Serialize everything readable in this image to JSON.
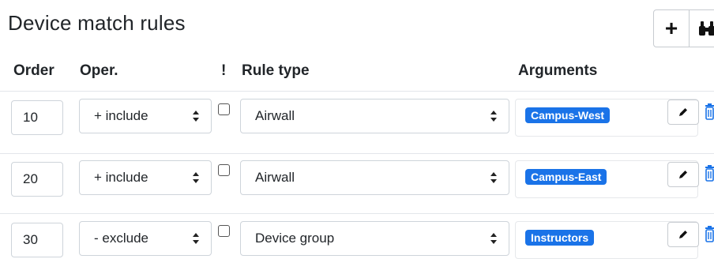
{
  "header": {
    "title": "Device match rules"
  },
  "toolbar": {
    "add_label": "+",
    "find_icon": "binoculars-icon"
  },
  "columns": {
    "order": "Order",
    "oper": "Oper.",
    "negate": "!",
    "rule_type": "Rule type",
    "arguments": "Arguments"
  },
  "rows": [
    {
      "order": "10",
      "oper": "+ include",
      "negate": false,
      "rule_type": "Airwall",
      "argument": "Campus-West"
    },
    {
      "order": "20",
      "oper": "+ include",
      "negate": false,
      "rule_type": "Airwall",
      "argument": "Campus-East"
    },
    {
      "order": "30",
      "oper": "- exclude",
      "negate": false,
      "rule_type": "Device group",
      "argument": "Instructors"
    }
  ],
  "colors": {
    "badge": "#1a73e8",
    "trash": "#1a73e8",
    "text": "#212529",
    "border": "#ced4da"
  },
  "icons": {
    "edit": "pencil-icon",
    "delete": "trash-icon",
    "select": "chevron-updown-icon"
  }
}
